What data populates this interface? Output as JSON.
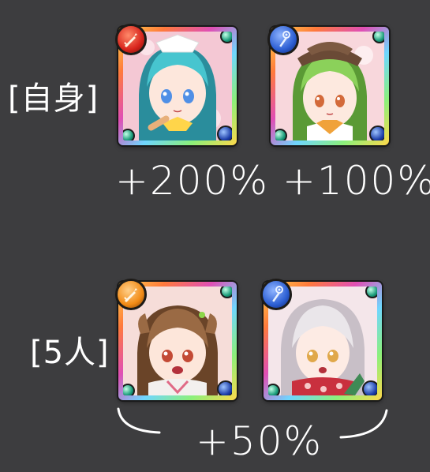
{
  "rows": [
    {
      "label": "[自身]",
      "units": [
        {
          "name": "aqua-maid-unit",
          "badge": "sword-icon",
          "hair": "#47c5cf",
          "hair_dark": "#2a8d9c",
          "eyes": "#4f8fe6",
          "bg": "#f4c8d4",
          "badge_color": "#d8251c"
        },
        {
          "name": "green-hair-unit",
          "badge": "staff-icon",
          "hair": "#8bd15a",
          "hair_dark": "#5a9a35",
          "eyes": "#d36a3a",
          "bg": "#f8d7dc",
          "badge_color": "#2d5fd3"
        }
      ],
      "bonuses": [
        "+200%",
        "+100%"
      ]
    },
    {
      "label": "[5人]",
      "units": [
        {
          "name": "brown-hair-unit",
          "badge": "sword-icon",
          "hair": "#9a6a44",
          "hair_dark": "#6a4428",
          "eyes": "#c34a35",
          "bg": "#f6ddd9",
          "badge_color": "#f28b16"
        },
        {
          "name": "white-hair-unit",
          "badge": "staff-icon",
          "hair": "#eae6ea",
          "hair_dark": "#c8bfc7",
          "eyes": "#e0a84a",
          "bg": "#f4e6ea",
          "badge_color": "#2d5fd3"
        }
      ],
      "bonuses": [
        "+50%"
      ]
    }
  ]
}
